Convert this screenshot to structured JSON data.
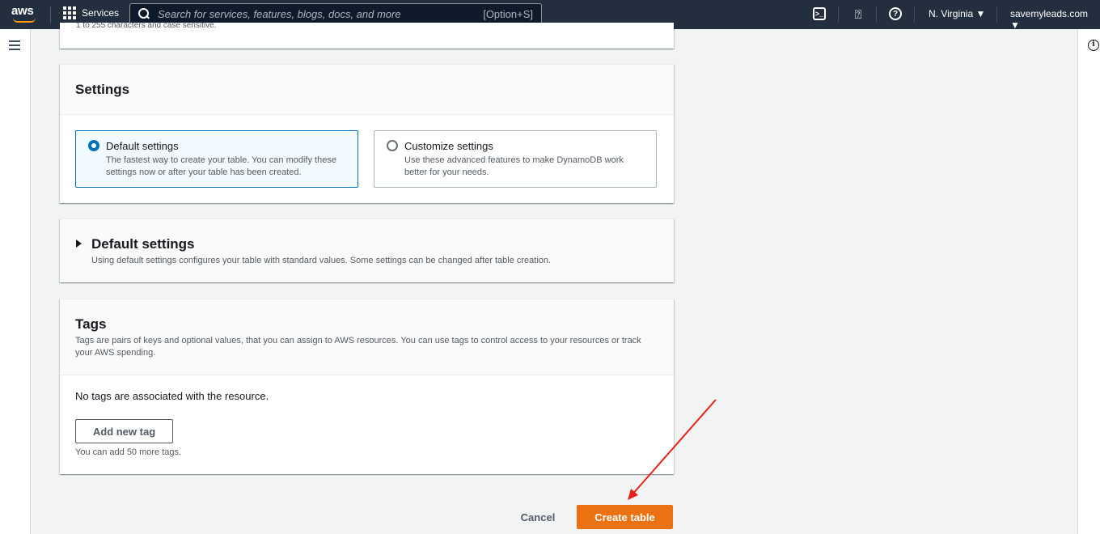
{
  "topnav": {
    "logo_text": "aws",
    "services_label": "Services",
    "search_placeholder": "Search for services, features, blogs, docs, and more",
    "search_shortcut": "[Option+S]",
    "region": "N. Virginia ▼",
    "account": "savemyleads.com ▼"
  },
  "top_panel": {
    "clipped_text": "1 to 255 characters and case sensitive."
  },
  "settings": {
    "title": "Settings",
    "options": [
      {
        "title": "Default settings",
        "description": "The fastest way to create your table. You can modify these settings now or after your table has been created.",
        "selected": true
      },
      {
        "title": "Customize settings",
        "description": "Use these advanced features to make DynamoDB work better for your needs.",
        "selected": false
      }
    ]
  },
  "default_settings": {
    "title": "Default settings",
    "description": "Using default settings configures your table with standard values. Some settings can be changed after table creation."
  },
  "tags": {
    "title": "Tags",
    "description": "Tags are pairs of keys and optional values, that you can assign to AWS resources. You can use tags to control access to your resources or track your AWS spending.",
    "empty_message": "No tags are associated with the resource.",
    "add_button": "Add new tag",
    "hint": "You can add 50 more tags."
  },
  "footer": {
    "cancel": "Cancel",
    "create": "Create table"
  },
  "colors": {
    "nav_bg": "#232f3e",
    "primary": "#ec7211",
    "selected_border": "#0073bb",
    "annotation_arrow": "#e8201a"
  }
}
